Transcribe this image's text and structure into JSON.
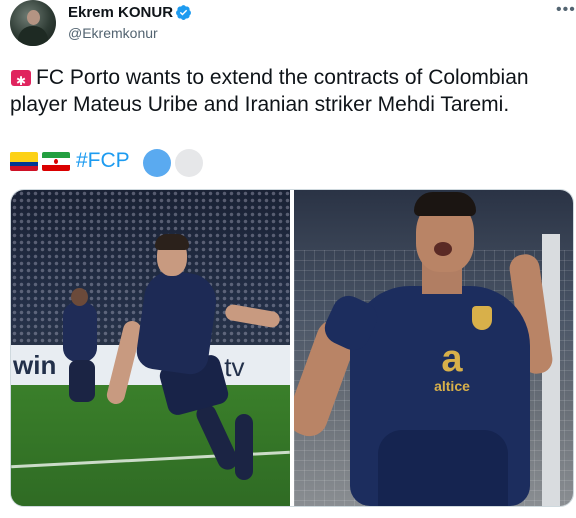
{
  "author": {
    "name": "Ekrem KONUR",
    "handle": "@Ekremkonur",
    "verified": true
  },
  "tweet": {
    "text": "FC Porto wants to extend the contracts of Colombian player Mateus Uribe and Iranian striker Mehdi Taremi.",
    "hashtag": "#FCP",
    "leading_icon": "siren-icon",
    "flags": [
      "colombia-flag",
      "iran-flag"
    ],
    "trailing_icons": [
      "blue-circle",
      "white-circle"
    ]
  },
  "media": {
    "left_photo": {
      "ad_text_left": "win",
      "ad_text_right": ".tv"
    },
    "right_photo": {
      "sponsor_logo": "a",
      "sponsor_text": "altice"
    }
  },
  "colors": {
    "accent": "#1d9bf0",
    "text": "#0f1419",
    "muted": "#536471"
  }
}
